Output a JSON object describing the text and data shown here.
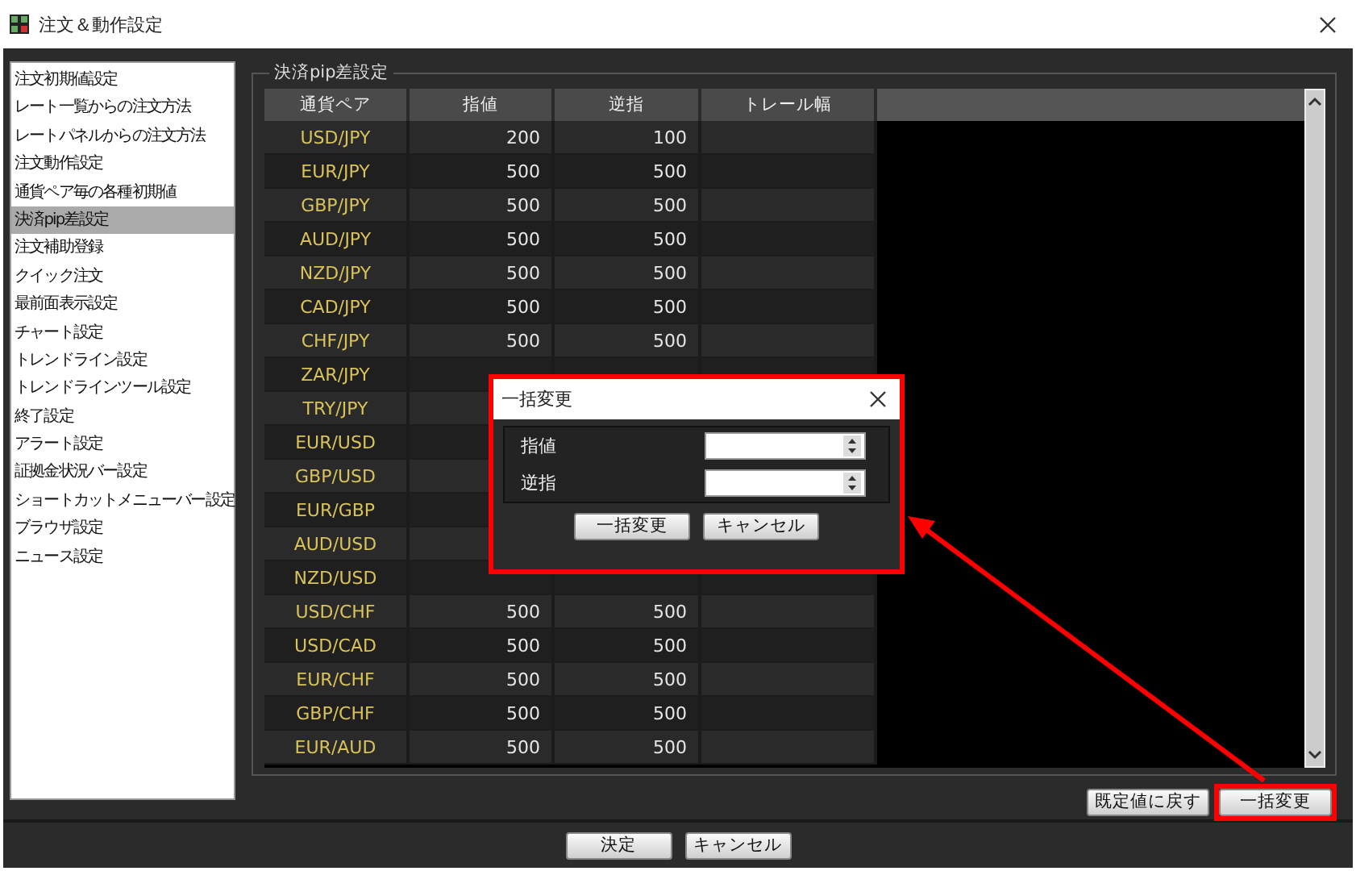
{
  "window": {
    "title": "注文＆動作設定"
  },
  "sidebar": {
    "items": [
      {
        "label": "注文初期値設定",
        "selected": false
      },
      {
        "label": "レート一覧からの注文方法",
        "selected": false
      },
      {
        "label": "レートパネルからの注文方法",
        "selected": false
      },
      {
        "label": "注文動作設定",
        "selected": false
      },
      {
        "label": "通貨ペア毎の各種初期値",
        "selected": false
      },
      {
        "label": "決済pip差設定",
        "selected": true
      },
      {
        "label": "注文補助登録",
        "selected": false
      },
      {
        "label": "クイック注文",
        "selected": false
      },
      {
        "label": "最前面表示設定",
        "selected": false
      },
      {
        "label": "チャート設定",
        "selected": false
      },
      {
        "label": "トレンドライン設定",
        "selected": false
      },
      {
        "label": "トレンドラインツール設定",
        "selected": false
      },
      {
        "label": "終了設定",
        "selected": false
      },
      {
        "label": "アラート設定",
        "selected": false
      },
      {
        "label": "証拠金状況バー設定",
        "selected": false
      },
      {
        "label": "ショートカットメニューバー設定",
        "selected": false
      },
      {
        "label": "ブラウザ設定",
        "selected": false
      },
      {
        "label": "ニュース設定",
        "selected": false
      }
    ]
  },
  "group": {
    "title": "決済pip差設定"
  },
  "table": {
    "columns": [
      "通貨ペア",
      "指値",
      "逆指",
      "トレール幅"
    ],
    "rows": [
      [
        "USD/JPY",
        "200",
        "100"
      ],
      [
        "EUR/JPY",
        "500",
        "500"
      ],
      [
        "GBP/JPY",
        "500",
        "500"
      ],
      [
        "AUD/JPY",
        "500",
        "500"
      ],
      [
        "NZD/JPY",
        "500",
        "500"
      ],
      [
        "CAD/JPY",
        "500",
        "500"
      ],
      [
        "CHF/JPY",
        "500",
        "500"
      ],
      [
        "ZAR/JPY"
      ],
      [
        "TRY/JPY"
      ],
      [
        "EUR/USD"
      ],
      [
        "GBP/USD"
      ],
      [
        "EUR/GBP"
      ],
      [
        "AUD/USD"
      ],
      [
        "NZD/USD"
      ],
      [
        "USD/CHF",
        "500",
        "500"
      ],
      [
        "USD/CAD",
        "500",
        "500"
      ],
      [
        "EUR/CHF",
        "500",
        "500"
      ],
      [
        "GBP/CHF",
        "500",
        "500"
      ],
      [
        "EUR/AUD",
        "500",
        "500"
      ]
    ]
  },
  "panel_buttons": [
    {
      "label": "既定値に戻す",
      "highlighted": false
    },
    {
      "label": "一括変更",
      "highlighted": true
    }
  ],
  "footer_buttons": [
    "決定",
    "キャンセル"
  ],
  "dialog": {
    "title": "一括変更",
    "highlighted": true,
    "fields": [
      {
        "label": "指値"
      },
      {
        "label": "逆指"
      }
    ],
    "buttons": [
      "一括変更",
      "キャンセル"
    ]
  }
}
